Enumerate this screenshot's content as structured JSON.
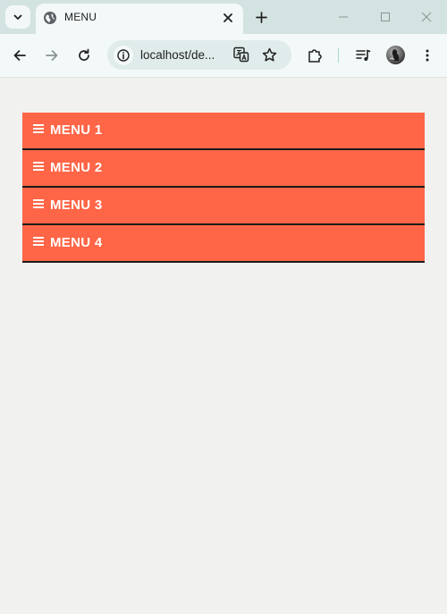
{
  "browser": {
    "tab": {
      "title": "MENU"
    },
    "address_bar": {
      "url": "localhost/de..."
    },
    "icons": {
      "tab_search": "chevron-down-icon",
      "favicon": "globe-icon",
      "close": "close-icon",
      "new_tab": "plus-icon",
      "back": "arrow-left-icon",
      "forward": "arrow-right-icon",
      "reload": "reload-icon",
      "site_info": "info-icon",
      "translate": "translate-icon",
      "bookmark": "star-icon",
      "extensions": "puzzle-icon",
      "media": "media-control-icon",
      "more": "kebab-menu-icon"
    }
  },
  "menu": {
    "items": [
      {
        "label": "MENU 1"
      },
      {
        "label": "MENU 2"
      },
      {
        "label": "MENU 3"
      },
      {
        "label": "MENU 4"
      }
    ]
  },
  "colors": {
    "menu_background": "#ff6647",
    "menu_border": "#1a1a1a",
    "menu_text": "#ffffff",
    "page_background": "#f1f1f0",
    "tabstrip_background": "#d3e3e1"
  }
}
